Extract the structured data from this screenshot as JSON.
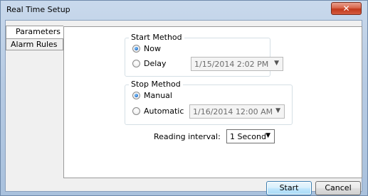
{
  "window": {
    "title": "Real Time Setup",
    "close_glyph": "✕"
  },
  "tabs": [
    {
      "label": "Parameters",
      "active": true
    },
    {
      "label": "Alarm Rules",
      "active": false
    }
  ],
  "start_method": {
    "title": "Start Method",
    "options": [
      {
        "label": "Now",
        "checked": true
      },
      {
        "label": "Delay",
        "checked": false
      }
    ],
    "delay_value": "1/15/2014 2:02 PM"
  },
  "stop_method": {
    "title": "Stop Method",
    "options": [
      {
        "label": "Manual",
        "checked": true
      },
      {
        "label": "Automatic",
        "checked": false
      }
    ],
    "automatic_value": "1/16/2014 12:00 AM"
  },
  "reading_interval": {
    "label": "Reading interval:",
    "value": "1 Second"
  },
  "buttons": {
    "start": "Start",
    "cancel": "Cancel"
  },
  "icons": {
    "dropdown": "chevron-down-icon",
    "close": "close-icon"
  }
}
